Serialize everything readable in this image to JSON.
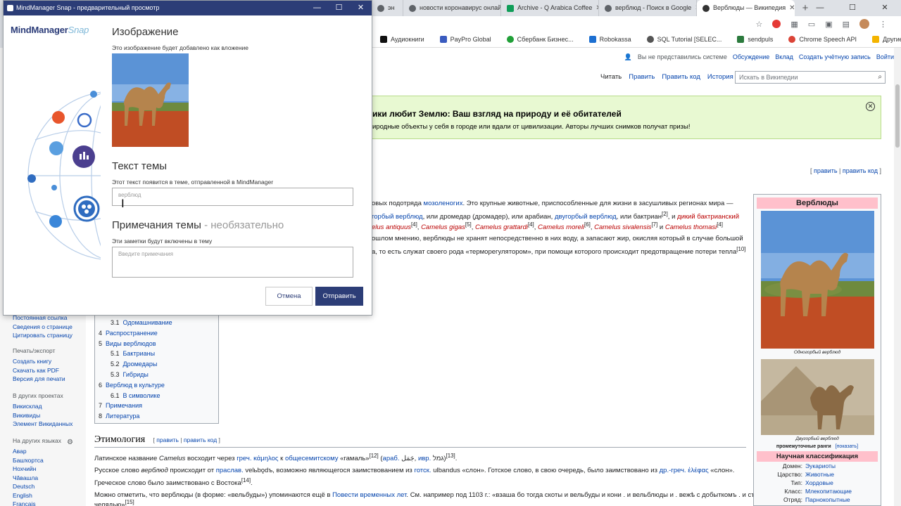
{
  "browser": {
    "tabs": [
      {
        "label": "эн",
        "icon_color": "#5f6368",
        "active": false
      },
      {
        "label": "новости коронавирус онлайн",
        "icon_color": "#5f6368",
        "active": false
      },
      {
        "label": "Archive - Q Arabica Coffee",
        "icon_color": "#0f9d58",
        "active": false
      },
      {
        "label": "верблюд - Поиск в Google",
        "icon_color": "#5f6368",
        "active": false
      },
      {
        "label": "Верблюды — Википедия",
        "icon_color": "#333333",
        "active": true
      }
    ],
    "new_tab": "+",
    "bookmarks": [
      "Аудиокниги",
      "PayPro Global",
      "Сбербанк Бизнес...",
      "Robokassa",
      "SQL Tutorial [SELEC...",
      "sendpuls",
      "Chrome Speech API"
    ],
    "bookmarks_right": "Другие закладки"
  },
  "snap": {
    "window_title": "MindManager Snap - предварительный просмотр",
    "logo_main": "MindManager",
    "logo_accent": "Snap",
    "image_heading": "Изображение",
    "image_sub": "Это изображение будет добавлено как вложение",
    "topic_heading": "Текст темы",
    "topic_sub": "Этот текст появится в теме, отправленной в MindManager",
    "topic_value": "верблюд",
    "notes_heading": "Примечания темы",
    "notes_optional": " - необязательно",
    "notes_sub": "Эти заметки будут включены в тему",
    "notes_placeholder": "Введите примечания",
    "cancel_label": "Отмена",
    "send_label": "Отправить",
    "brand_color": "#2c3d77"
  },
  "wiki": {
    "user_links": [
      "Вы не представились системе",
      "Обсуждение",
      "Вклад",
      "Создать учётную запись",
      "Войти"
    ],
    "view_tabs": [
      "Читать",
      "Править",
      "Править код",
      "История"
    ],
    "search_placeholder": "Искать в Википедии",
    "banner_title": "ики любит Землю: Ваш взгляд на природу и её обитателей",
    "banner_text": "иродные объекты у себя в городе или вдали от цивилизации. Авторы лучших снимков получат призы!",
    "edit_links": [
      "править",
      "править код"
    ],
    "sidebar": {
      "tools": [
        "Постоянная ссылка",
        "Сведения о странице",
        "Цитировать страницу"
      ],
      "print_heading": "Печать/экспорт",
      "print": [
        "Создать книгу",
        "Скачать как PDF",
        "Версия для печати"
      ],
      "projects_heading": "В других проектах",
      "projects": [
        "Викисклад",
        "Викивиды",
        "Элемент Викиданных"
      ],
      "langs_heading": "На других языках",
      "langs": [
        "Авар",
        "Башҡортса",
        "Нохчийн",
        "Чăвашла",
        "Deutsch",
        "English",
        "Français"
      ]
    },
    "toc": [
      {
        "n": "3.1",
        "t": "Одомашнивание",
        "sub": true
      },
      {
        "n": "4",
        "t": "Распространение",
        "sub": false
      },
      {
        "n": "5",
        "t": "Виды верблюдов",
        "sub": false
      },
      {
        "n": "5.1",
        "t": "Бактрианы",
        "sub": true
      },
      {
        "n": "5.2",
        "t": "Дромедары",
        "sub": true
      },
      {
        "n": "5.3",
        "t": "Гибриды",
        "sub": true
      },
      {
        "n": "6",
        "t": "Верблюд в культуре",
        "sub": false
      },
      {
        "n": "6.1",
        "t": "В символике",
        "sub": true
      },
      {
        "n": "7",
        "t": "Примечания",
        "sub": false
      },
      {
        "n": "8",
        "t": "Литература",
        "sub": false
      }
    ],
    "section_title": "Этимология",
    "section_edit": [
      "править",
      "править код"
    ],
    "infobox": {
      "title": "Верблюды",
      "cap1": "Одногорбый верблюд",
      "cap2": "Двугорбый верблюд",
      "ranks": "промежуточные ранги",
      "show": "[показать]",
      "class_title": "Научная классификация",
      "rows": [
        {
          "k": "Домен:",
          "v": "Эукариоты"
        },
        {
          "k": "Царство:",
          "v": "Животные"
        },
        {
          "k": "Тип:",
          "v": "Хордовые"
        },
        {
          "k": "Класс:",
          "v": "Млекопитающие"
        },
        {
          "k": "Отряд:",
          "v": "Парнокопытные"
        }
      ]
    }
  }
}
